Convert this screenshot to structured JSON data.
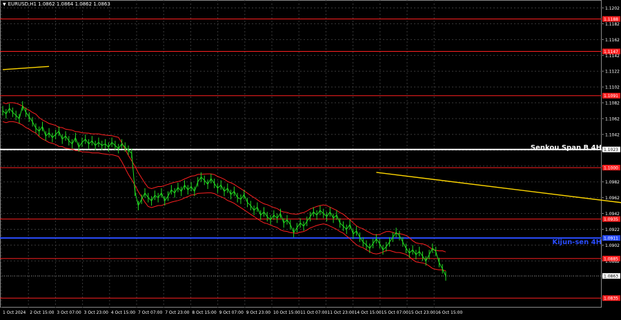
{
  "chart_data": {
    "type": "line",
    "symbol_header": "EURUSD,H1  1.0862 1.0864 1.0862 1.0863",
    "ylim": [
      1.0823,
      1.1212
    ],
    "y_ticks": [
      "1.1202",
      "1.1182",
      "1.1162",
      "1.1142",
      "1.1122",
      "1.1102",
      "1.1082",
      "1.1062",
      "1.1042",
      "1.1022",
      "1.1002",
      "1.0982",
      "1.0962",
      "1.0942",
      "1.0922",
      "1.0902",
      "1.0882",
      "1.0863"
    ],
    "x_ticks": [
      "1 Oct 2024",
      "2 Oct 15:00",
      "3 Oct 07:00",
      "3 Oct 23:00",
      "4 Oct 15:00",
      "7 Oct 07:00",
      "7 Oct 23:00",
      "8 Oct 15:00",
      "9 Oct 07:00",
      "9 Oct 23:00",
      "10 Oct 15:00",
      "11 Oct 07:00",
      "11 Oct 23:00",
      "14 Oct 15:00",
      "15 Oct 07:00",
      "15 Oct 23:00",
      "16 Oct 15:00"
    ],
    "levels": [
      {
        "label": "1.1188",
        "value": 1.1188,
        "color": "#ff2020"
      },
      {
        "label": "1.1147",
        "value": 1.1147,
        "color": "#ff2020"
      },
      {
        "label": "1.1091",
        "value": 1.1091,
        "color": "#ff2020"
      },
      {
        "label": "1.1023",
        "value": 1.1023,
        "color": "#ffffff",
        "name": "Senkou Span B 4H"
      },
      {
        "label": "1.1000",
        "value": 1.1,
        "color": "#ff2020"
      },
      {
        "label": "1.0935",
        "value": 1.0935,
        "color": "#ff2020"
      },
      {
        "label": "1.0911",
        "value": 1.0911,
        "color": "#2a4dff",
        "name": "Kijun-sen 4H"
      },
      {
        "label": "1.0885",
        "value": 1.0885,
        "color": "#ff2020"
      },
      {
        "label": "1.0835",
        "value": 1.0835,
        "color": "#ff2020"
      }
    ],
    "last_price_label": "1.0863",
    "last_price": 1.0863,
    "annotations": [
      "Senkou Span B 4H",
      "Kijun-sen 4H"
    ],
    "price_series": {
      "color": "#22dd22",
      "values": [
        1.1072,
        1.1068,
        1.1075,
        1.107,
        1.1066,
        1.1062,
        1.1078,
        1.107,
        1.1064,
        1.1058,
        1.105,
        1.1046,
        1.1052,
        1.104,
        1.1044,
        1.1038,
        1.1042,
        1.1046,
        1.1036,
        1.104,
        1.1034,
        1.103,
        1.1038,
        1.1026,
        1.1032,
        1.1036,
        1.103,
        1.1034,
        1.1028,
        1.1032,
        1.1028,
        1.103,
        1.1026,
        1.1032,
        1.1028,
        1.1024,
        1.103,
        1.1026,
        1.1022,
        1.1018,
        1.097,
        1.0952,
        1.096,
        1.0968,
        1.0962,
        1.0958,
        1.0965,
        1.0962,
        1.0968,
        1.0958,
        1.0964,
        1.0972,
        1.0968,
        1.0975,
        1.097,
        1.0978,
        1.0972,
        1.0976,
        1.097,
        1.0982,
        1.0988,
        1.0984,
        1.0979,
        1.0986,
        1.098,
        1.0974,
        1.0978,
        1.097,
        1.0974,
        1.0966,
        1.097,
        1.0962,
        1.096,
        1.0966,
        1.0956,
        1.0952,
        1.0946,
        1.095,
        1.094,
        1.0944,
        1.0938,
        1.0934,
        1.094,
        1.0936,
        1.0942,
        1.093,
        1.0934,
        1.0928,
        1.0918,
        1.0924,
        1.093,
        1.0926,
        1.0932,
        1.0938,
        1.0944,
        1.094,
        1.0946,
        1.0942,
        1.0938,
        1.0944,
        1.0936,
        1.094,
        1.093,
        1.0926,
        1.0922,
        1.0928,
        1.0916,
        1.092,
        1.0912,
        1.0906,
        1.0902,
        1.0898,
        1.0904,
        1.091,
        1.0904,
        1.0896,
        1.09,
        1.0906,
        1.0912,
        1.0918,
        1.0914,
        1.0906,
        1.0898,
        1.0892,
        1.0896,
        1.089,
        1.0894,
        1.0888,
        1.0882,
        1.089,
        1.0898,
        1.0894,
        1.088,
        1.0872,
        1.0863
      ]
    },
    "ichimoku_cloud_color": "#ff2020",
    "trendlines": [
      {
        "color": "#ffd700",
        "from": [
          0,
          1.1124
        ],
        "to": [
          14,
          1.1128
        ]
      },
      {
        "color": "#ffd700",
        "from": [
          113,
          1.0994
        ],
        "to": [
          330,
          1.0882
        ]
      }
    ]
  }
}
